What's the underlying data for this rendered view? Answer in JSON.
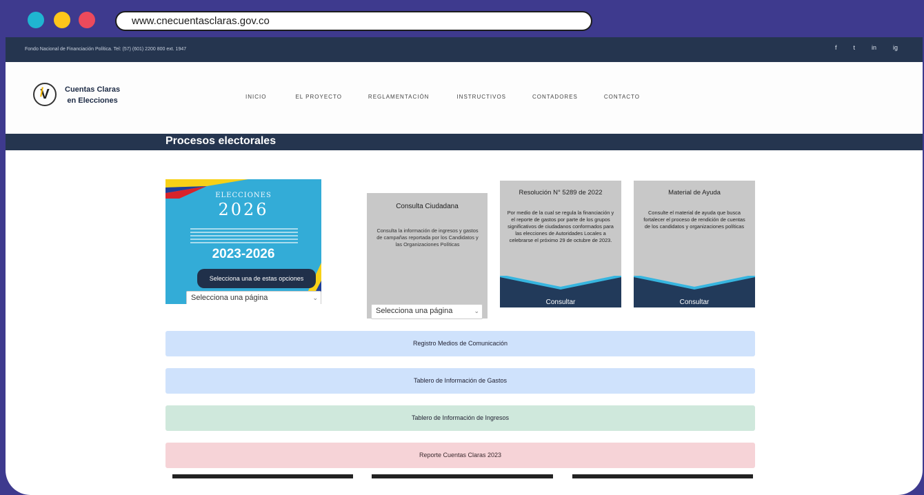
{
  "browser": {
    "url": "www.cnecuentasclaras.gov.co",
    "dots": [
      "#1fb5d1",
      "#ffc61a",
      "#ec4a5c"
    ]
  },
  "topbar": {
    "info": "Fondo Nacional de Financiación Política. Tel: (57) (601) 2200 800 ext. 1947",
    "social": [
      "f",
      "t",
      "in",
      "ig"
    ]
  },
  "logo": {
    "line1": "Cuentas Claras",
    "line2": "en Elecciones"
  },
  "nav": {
    "items": [
      "INICIO",
      "EL PROYECTO",
      "REGLAMENTACIÓN",
      "INSTRUCTIVOS",
      "CONTADORES",
      "CONTACTO"
    ]
  },
  "banner": {
    "title": "Procesos electorales"
  },
  "elections_card": {
    "label": "ELECCIONES",
    "year": "2026",
    "range": "2023-2026",
    "pill": "Selecciona una de estas opciones",
    "select": "Selecciona una página"
  },
  "consulta_card": {
    "title": "Consulta Ciudadana",
    "text": "Consulta la información de ingresos y gastos de campañas reportada por los Candidatos y las Organizaciones Políticas",
    "select": "Selecciona una página"
  },
  "resolucion_card": {
    "title": "Resolución N° 5289 de 2022",
    "text": "Por medio de la cual se regula la financiación y el reporte de gastos por parte de los grupos significativos de ciudadanos conformados para las elecciones de Autoridades Locales a celebrarse el próximo 29 de octubre de 2023.",
    "button": "Consultar"
  },
  "material_card": {
    "title": "Material de Ayuda",
    "text": "Consulte el material de ayuda que busca fortalecer el proceso de rendición de cuentas de los candidatos y organizaciones políticas",
    "button": "Consultar"
  },
  "bars": {
    "b1": "Registro Medios de Comunicación",
    "b2": "Tablero de Información de Gastos",
    "b3": "Tablero de Información de Ingresos",
    "b4": "Reporte Cuentas Claras 2023"
  },
  "colors": {
    "frame": "#3e3a8e",
    "navy": "#25354f",
    "sky": "#33acd7"
  }
}
